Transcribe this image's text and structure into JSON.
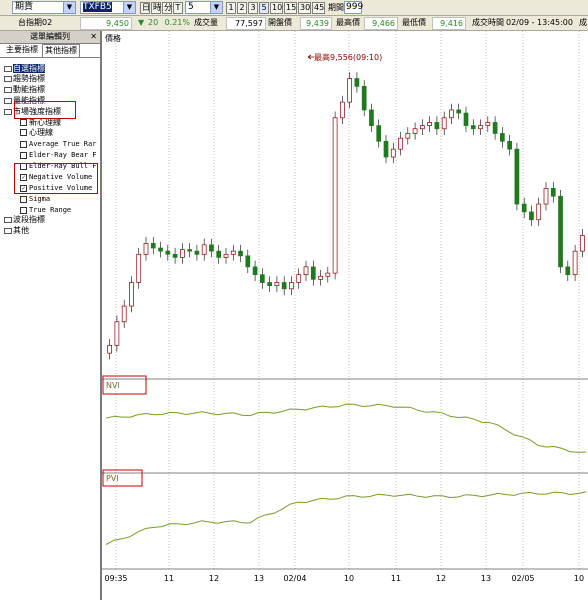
{
  "toolbar": {
    "market_select": "期貨",
    "symbol": "TXFB5",
    "interval_buttons": [
      "日",
      "時",
      "分",
      "T"
    ],
    "interval_value": "5",
    "minute_buttons": [
      "1",
      "2",
      "3",
      "5",
      "10",
      "15",
      "30",
      "45"
    ],
    "period_label": "期間",
    "period_value": "999"
  },
  "quote": {
    "name": "台指期02",
    "price": "9,450",
    "change": "20",
    "change_pct": "0.21%",
    "volume_label": "成交量",
    "volume": "77,597",
    "open_label": "開盤價",
    "open": "9,439",
    "high_label": "最高價",
    "high": "9,466",
    "low_label": "最低價",
    "low": "9,416",
    "time_label": "成交時間",
    "time": "02/09 - 13:45:00",
    "extra": "成"
  },
  "left_panel": {
    "title": "選單編輯列",
    "tabs": [
      "主要指標",
      "其他指標"
    ],
    "tree": [
      {
        "label": "自選指標",
        "type": "folder",
        "selected": true
      },
      {
        "label": "趨勢指標",
        "type": "folder"
      },
      {
        "label": "動能指標",
        "type": "folder"
      },
      {
        "label": "量能指標",
        "type": "folder"
      },
      {
        "label": "市場強度指標",
        "type": "folder",
        "open": true
      },
      {
        "label": "新心理線",
        "type": "check",
        "checked": false
      },
      {
        "label": "心理線",
        "type": "check",
        "checked": false
      },
      {
        "label": "Average True Rar",
        "type": "check",
        "checked": false
      },
      {
        "label": "Elder-Ray Bear F",
        "type": "check",
        "checked": false
      },
      {
        "label": "Elder-Ray Bull F",
        "type": "check",
        "checked": false
      },
      {
        "label": "Negative Volume",
        "type": "check",
        "checked": true
      },
      {
        "label": "Positive Volume",
        "type": "check",
        "checked": true
      },
      {
        "label": "Sigma",
        "type": "check",
        "checked": false
      },
      {
        "label": "True Range",
        "type": "check",
        "checked": false
      },
      {
        "label": "波段指標",
        "type": "folder"
      },
      {
        "label": "其他",
        "type": "folder"
      }
    ]
  },
  "chart": {
    "price_label": "價格",
    "high_annotation": "最高9,556(09:10)",
    "nvi_label": "NVI",
    "pvi_label": "PVI",
    "x_labels": [
      "09:35",
      "11",
      "12",
      "13",
      "02/04",
      "10",
      "11",
      "12",
      "13",
      "02/05",
      "10"
    ],
    "colors": {
      "up": "#8b0000",
      "down": "#1f7a1f",
      "grid": "#c0c0c0",
      "indicator_line": "#7a9a2a",
      "annotation_box": "#c00000"
    }
  },
  "chart_data": {
    "type": "line",
    "title": "",
    "x": [
      "09:35",
      "11",
      "12",
      "13",
      "02/04",
      "10",
      "11",
      "12",
      "13",
      "02/05",
      "10"
    ],
    "series": [
      {
        "name": "NVI",
        "values": [
          0.6,
          0.65,
          0.66,
          0.64,
          0.7,
          0.75,
          0.74,
          0.65,
          0.55,
          0.3,
          0.2
        ]
      },
      {
        "name": "PVI",
        "values": [
          0.25,
          0.45,
          0.5,
          0.5,
          0.72,
          0.78,
          0.8,
          0.78,
          0.8,
          0.82,
          0.82
        ]
      }
    ],
    "price_candles": [
      9380,
      9395,
      9405,
      9420,
      9438,
      9445,
      9442,
      9440,
      9438,
      9436,
      9441,
      9440,
      9438,
      9444,
      9440,
      9436,
      9438,
      9440,
      9437,
      9430,
      9425,
      9420,
      9418,
      9420,
      9416,
      9420,
      9425,
      9430,
      9422,
      9424,
      9426,
      9525,
      9535,
      9550,
      9545,
      9530,
      9520,
      9510,
      9500,
      9505,
      9512,
      9515,
      9518,
      9520,
      9522,
      9518,
      9525,
      9530,
      9528,
      9520,
      9518,
      9520,
      9522,
      9515,
      9510,
      9505,
      9470,
      9465,
      9460,
      9470,
      9480,
      9475,
      9430,
      9425,
      9440,
      9450
    ]
  }
}
